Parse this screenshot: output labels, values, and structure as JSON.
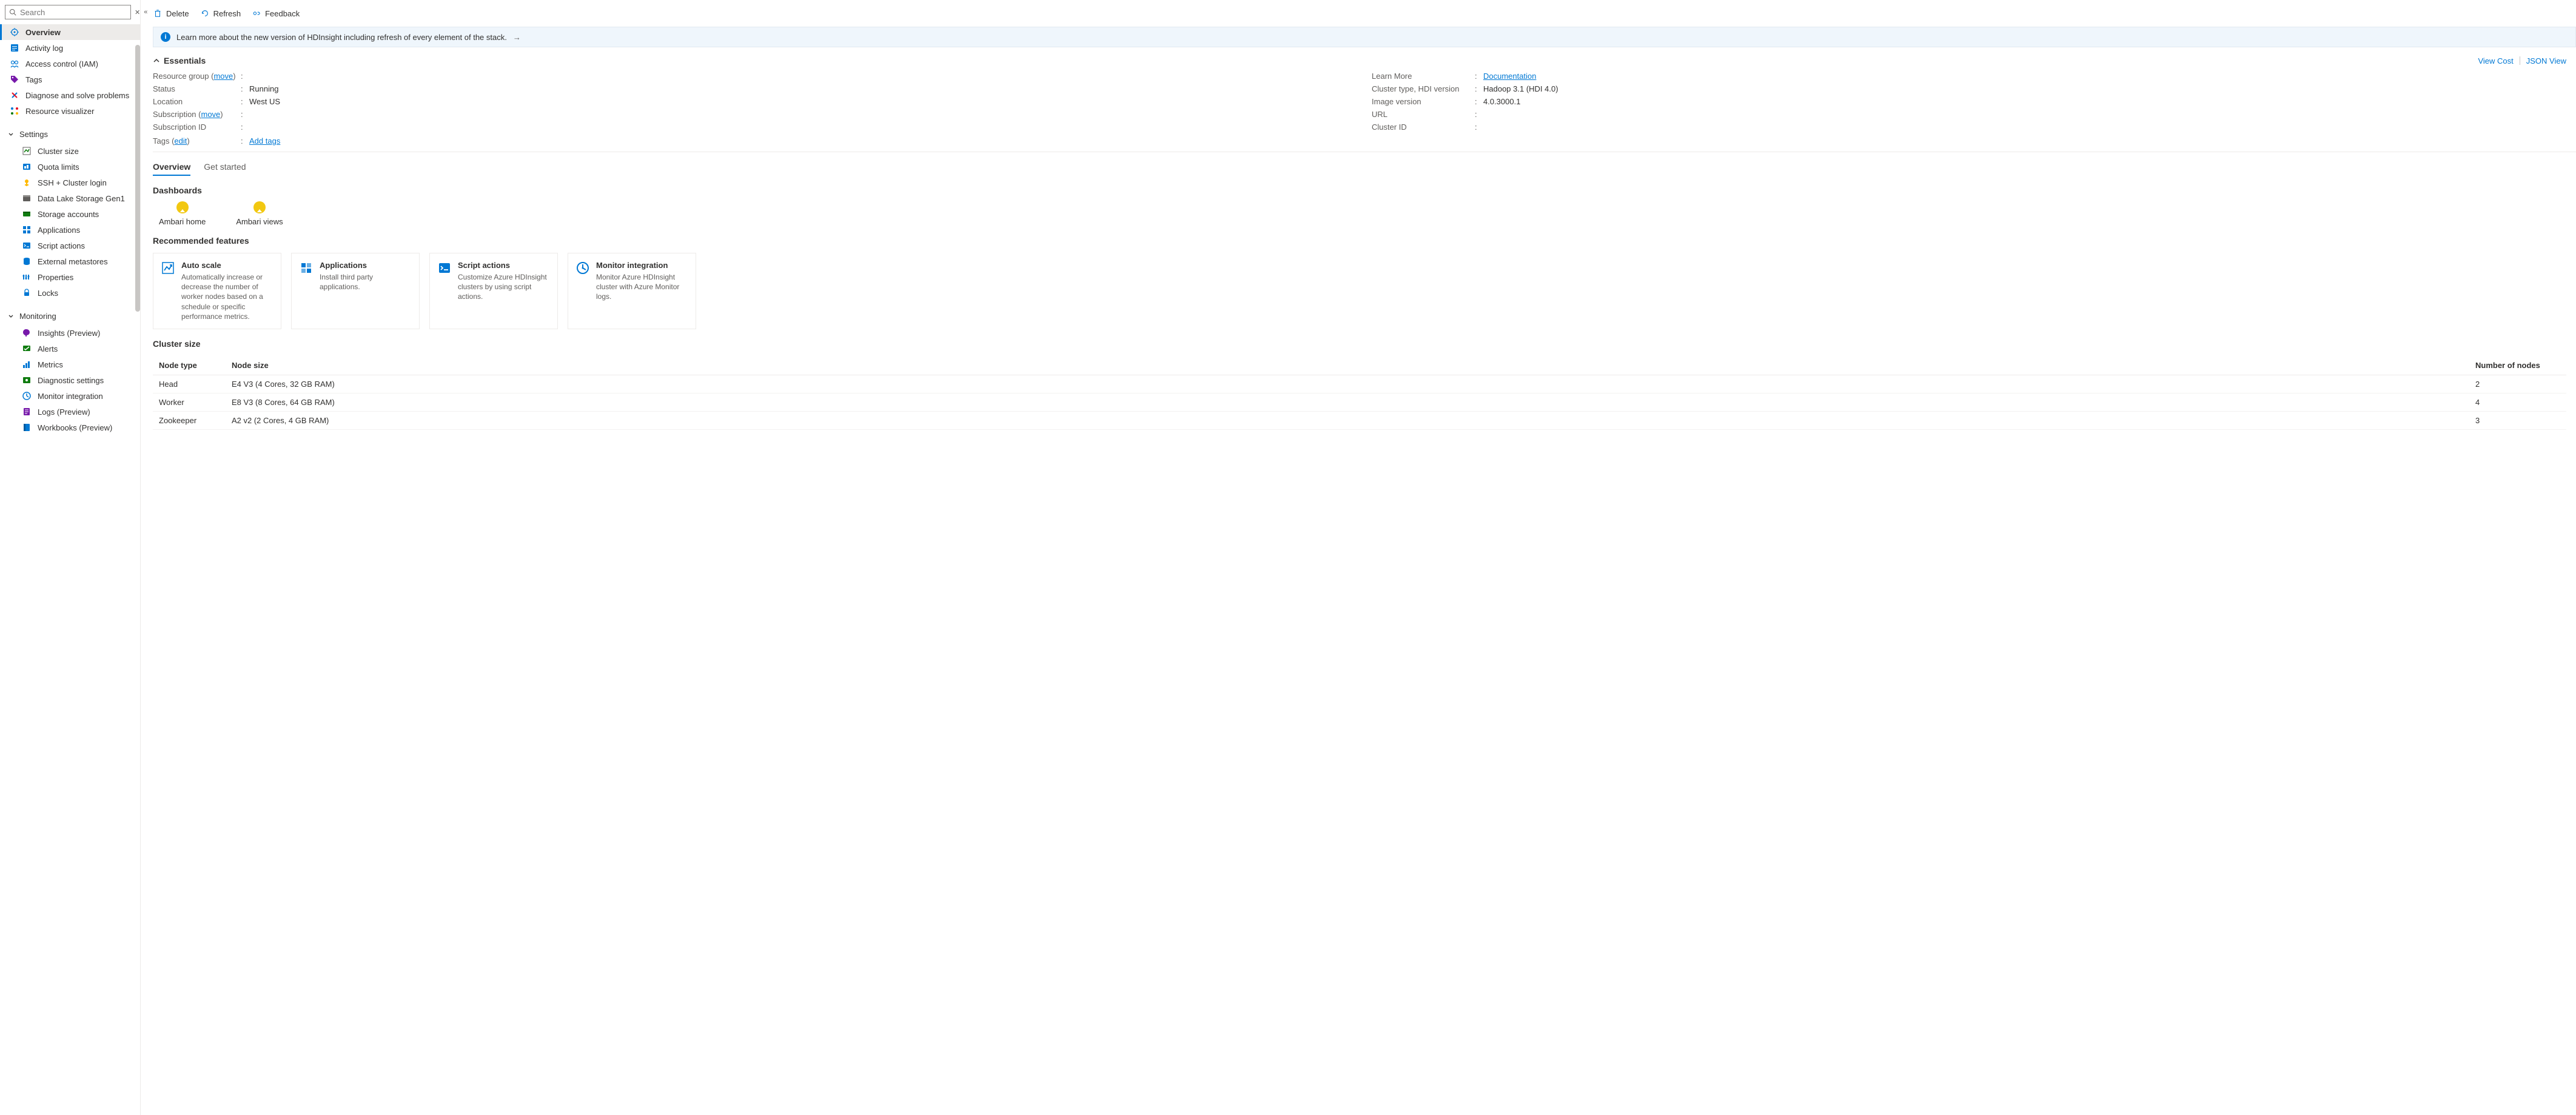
{
  "search": {
    "placeholder": "Search"
  },
  "sidebar": {
    "items": [
      {
        "label": "Overview",
        "icon": "overview",
        "active": true
      },
      {
        "label": "Activity log",
        "icon": "activity"
      },
      {
        "label": "Access control (IAM)",
        "icon": "iam"
      },
      {
        "label": "Tags",
        "icon": "tags"
      },
      {
        "label": "Diagnose and solve problems",
        "icon": "diagnose"
      },
      {
        "label": "Resource visualizer",
        "icon": "visualizer"
      }
    ],
    "groups": [
      {
        "label": "Settings",
        "items": [
          {
            "label": "Cluster size",
            "icon": "clustersize"
          },
          {
            "label": "Quota limits",
            "icon": "quota"
          },
          {
            "label": "SSH + Cluster login",
            "icon": "ssh"
          },
          {
            "label": "Data Lake Storage Gen1",
            "icon": "datalake"
          },
          {
            "label": "Storage accounts",
            "icon": "storage"
          },
          {
            "label": "Applications",
            "icon": "apps"
          },
          {
            "label": "Script actions",
            "icon": "script"
          },
          {
            "label": "External metastores",
            "icon": "metastore"
          },
          {
            "label": "Properties",
            "icon": "properties"
          },
          {
            "label": "Locks",
            "icon": "locks"
          }
        ]
      },
      {
        "label": "Monitoring",
        "items": [
          {
            "label": "Insights (Preview)",
            "icon": "insights"
          },
          {
            "label": "Alerts",
            "icon": "alerts"
          },
          {
            "label": "Metrics",
            "icon": "metrics"
          },
          {
            "label": "Diagnostic settings",
            "icon": "diagsettings"
          },
          {
            "label": "Monitor integration",
            "icon": "monitor"
          },
          {
            "label": "Logs (Preview)",
            "icon": "logs"
          },
          {
            "label": "Workbooks (Preview)",
            "icon": "workbooks"
          }
        ]
      }
    ]
  },
  "commands": {
    "delete": "Delete",
    "refresh": "Refresh",
    "feedback": "Feedback"
  },
  "banner": {
    "text": "Learn more about the new version of HDInsight including refresh of every element of the stack."
  },
  "essentials": {
    "title": "Essentials",
    "viewCost": "View Cost",
    "jsonView": "JSON View",
    "left": [
      {
        "key": "Resource group",
        "move": "move",
        "val": ""
      },
      {
        "key": "Status",
        "val": "Running"
      },
      {
        "key": "Location",
        "val": "West US"
      },
      {
        "key": "Subscription",
        "move": "move",
        "val": ""
      },
      {
        "key": "Subscription ID",
        "val": ""
      }
    ],
    "right": [
      {
        "key": "Learn More",
        "val": "Documentation",
        "link": true
      },
      {
        "key": "Cluster type, HDI version",
        "val": "Hadoop 3.1 (HDI 4.0)"
      },
      {
        "key": "Image version",
        "val": "4.0.3000.1"
      },
      {
        "key": "URL",
        "val": ""
      },
      {
        "key": "Cluster ID",
        "val": ""
      }
    ],
    "tags": {
      "key": "Tags",
      "edit": "edit",
      "val": "Add tags"
    }
  },
  "tabs": {
    "overview": "Overview",
    "getStarted": "Get started"
  },
  "dashboards": {
    "heading": "Dashboards",
    "items": [
      {
        "label": "Ambari home"
      },
      {
        "label": "Ambari views"
      }
    ]
  },
  "recommended": {
    "heading": "Recommended features",
    "cards": [
      {
        "title": "Auto scale",
        "desc": "Automatically increase or decrease the number of worker nodes based on a schedule or specific performance metrics.",
        "icon": "autoscale"
      },
      {
        "title": "Applications",
        "desc": "Install third party applications.",
        "icon": "apps-card"
      },
      {
        "title": "Script actions",
        "desc": "Customize Azure HDInsight clusters by using script actions.",
        "icon": "script-card"
      },
      {
        "title": "Monitor integration",
        "desc": "Monitor Azure HDInsight cluster with Azure Monitor logs.",
        "icon": "monitor-card"
      }
    ]
  },
  "clusterSize": {
    "heading": "Cluster size",
    "headers": {
      "type": "Node type",
      "size": "Node size",
      "count": "Number of nodes"
    },
    "rows": [
      {
        "type": "Head",
        "size": "E4 V3 (4 Cores, 32 GB RAM)",
        "count": "2"
      },
      {
        "type": "Worker",
        "size": "E8 V3 (8 Cores, 64 GB RAM)",
        "count": "4"
      },
      {
        "type": "Zookeeper",
        "size": "A2 v2 (2 Cores, 4 GB RAM)",
        "count": "3"
      }
    ]
  }
}
